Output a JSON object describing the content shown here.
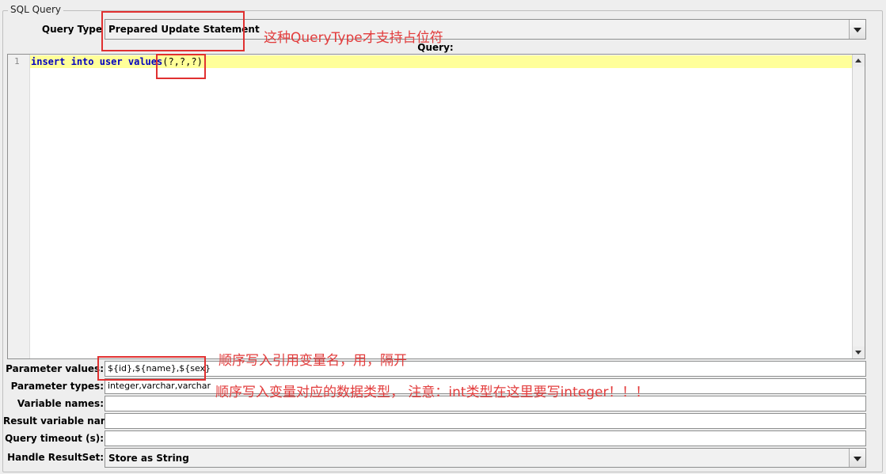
{
  "group": {
    "title": "SQL Query"
  },
  "query_type": {
    "label": "Query Type",
    "value": "Prepared Update Statement"
  },
  "query": {
    "label": "Query:",
    "line_numbers": [
      "1"
    ],
    "code": {
      "kw1": "insert",
      "kw2": "into",
      "word3": "user",
      "kw4": "values",
      "rest": "(?,?,?)"
    }
  },
  "fields": {
    "parameter_values": {
      "label": "Parameter values:",
      "value": "${id},${name},${sex}"
    },
    "parameter_types": {
      "label": "Parameter types:",
      "value": "integer,varchar,varchar"
    },
    "variable_names": {
      "label": "Variable names:",
      "value": ""
    },
    "result_variable_name": {
      "label": "Result variable name:",
      "value": ""
    },
    "query_timeout": {
      "label": "Query timeout (s):",
      "value": ""
    }
  },
  "handle_resultset": {
    "label": "Handle ResultSet:",
    "value": "Store as String"
  },
  "annotations": {
    "query_type_note": "这种QueryType才支持占位符",
    "param_values_note": "顺序写入引用变量名，用，隔开",
    "param_types_note": "顺序写入变量对应的数据类型， 注意：int类型在这里要写integer！！！"
  },
  "colors": {
    "annotation": "#e23c3c",
    "highlight_line": "#ffff99",
    "keyword": "#0000c0"
  }
}
